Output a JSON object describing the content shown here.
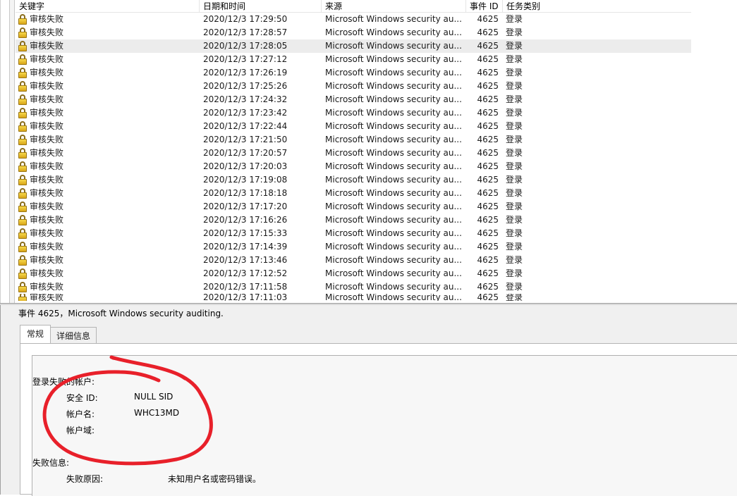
{
  "columns": {
    "keyword": "关键字",
    "datetime": "日期和时间",
    "source": "来源",
    "event_id": "事件 ID",
    "task_category": "任务类别"
  },
  "rows": [
    {
      "keyword": "审核失败",
      "datetime": "2020/12/3 17:29:50",
      "source": "Microsoft Windows security au...",
      "event_id": "4625",
      "task": "登录"
    },
    {
      "keyword": "审核失败",
      "datetime": "2020/12/3 17:28:57",
      "source": "Microsoft Windows security au...",
      "event_id": "4625",
      "task": "登录"
    },
    {
      "keyword": "审核失败",
      "datetime": "2020/12/3 17:28:05",
      "source": "Microsoft Windows security au...",
      "event_id": "4625",
      "task": "登录"
    },
    {
      "keyword": "审核失败",
      "datetime": "2020/12/3 17:27:12",
      "source": "Microsoft Windows security au...",
      "event_id": "4625",
      "task": "登录"
    },
    {
      "keyword": "审核失败",
      "datetime": "2020/12/3 17:26:19",
      "source": "Microsoft Windows security au...",
      "event_id": "4625",
      "task": "登录"
    },
    {
      "keyword": "审核失败",
      "datetime": "2020/12/3 17:25:26",
      "source": "Microsoft Windows security au...",
      "event_id": "4625",
      "task": "登录"
    },
    {
      "keyword": "审核失败",
      "datetime": "2020/12/3 17:24:32",
      "source": "Microsoft Windows security au...",
      "event_id": "4625",
      "task": "登录"
    },
    {
      "keyword": "审核失败",
      "datetime": "2020/12/3 17:23:42",
      "source": "Microsoft Windows security au...",
      "event_id": "4625",
      "task": "登录"
    },
    {
      "keyword": "审核失败",
      "datetime": "2020/12/3 17:22:44",
      "source": "Microsoft Windows security au...",
      "event_id": "4625",
      "task": "登录"
    },
    {
      "keyword": "审核失败",
      "datetime": "2020/12/3 17:21:50",
      "source": "Microsoft Windows security au...",
      "event_id": "4625",
      "task": "登录"
    },
    {
      "keyword": "审核失败",
      "datetime": "2020/12/3 17:20:57",
      "source": "Microsoft Windows security au...",
      "event_id": "4625",
      "task": "登录"
    },
    {
      "keyword": "审核失败",
      "datetime": "2020/12/3 17:20:03",
      "source": "Microsoft Windows security au...",
      "event_id": "4625",
      "task": "登录"
    },
    {
      "keyword": "审核失败",
      "datetime": "2020/12/3 17:19:08",
      "source": "Microsoft Windows security au...",
      "event_id": "4625",
      "task": "登录"
    },
    {
      "keyword": "审核失败",
      "datetime": "2020/12/3 17:18:18",
      "source": "Microsoft Windows security au...",
      "event_id": "4625",
      "task": "登录"
    },
    {
      "keyword": "审核失败",
      "datetime": "2020/12/3 17:17:20",
      "source": "Microsoft Windows security au...",
      "event_id": "4625",
      "task": "登录"
    },
    {
      "keyword": "审核失败",
      "datetime": "2020/12/3 17:16:26",
      "source": "Microsoft Windows security au...",
      "event_id": "4625",
      "task": "登录"
    },
    {
      "keyword": "审核失败",
      "datetime": "2020/12/3 17:15:33",
      "source": "Microsoft Windows security au...",
      "event_id": "4625",
      "task": "登录"
    },
    {
      "keyword": "审核失败",
      "datetime": "2020/12/3 17:14:39",
      "source": "Microsoft Windows security au...",
      "event_id": "4625",
      "task": "登录"
    },
    {
      "keyword": "审核失败",
      "datetime": "2020/12/3 17:13:46",
      "source": "Microsoft Windows security au...",
      "event_id": "4625",
      "task": "登录"
    },
    {
      "keyword": "审核失败",
      "datetime": "2020/12/3 17:12:52",
      "source": "Microsoft Windows security au...",
      "event_id": "4625",
      "task": "登录"
    },
    {
      "keyword": "审核失败",
      "datetime": "2020/12/3 17:11:58",
      "source": "Microsoft Windows security au...",
      "event_id": "4625",
      "task": "登录"
    },
    {
      "keyword": "审核失败",
      "datetime": "2020/12/3 17:11:03",
      "source": "Microsoft Windows security au...",
      "event_id": "4625",
      "task": "登录"
    }
  ],
  "selected_row_index": 2,
  "row_icon": "lock-icon",
  "detail": {
    "title": "事件 4625，Microsoft Windows security auditing.",
    "tabs": [
      "常规",
      "详细信息"
    ],
    "active_tab": 0,
    "section_account": "登录失败的帐户:",
    "security_id_label": "安全 ID:",
    "security_id_value": "NULL SID",
    "account_name_label": "帐户名:",
    "account_name_value": "WHC13MD",
    "account_domain_label": "帐户域:",
    "account_domain_value": "",
    "section_failure": "失败信息:",
    "failure_reason_label": "失败原因:",
    "failure_reason_value": "未知用户名或密码错误。"
  },
  "colors": {
    "selected_row": "#ececec",
    "annotation": "#e8202a",
    "lock": "#e8b72a"
  }
}
